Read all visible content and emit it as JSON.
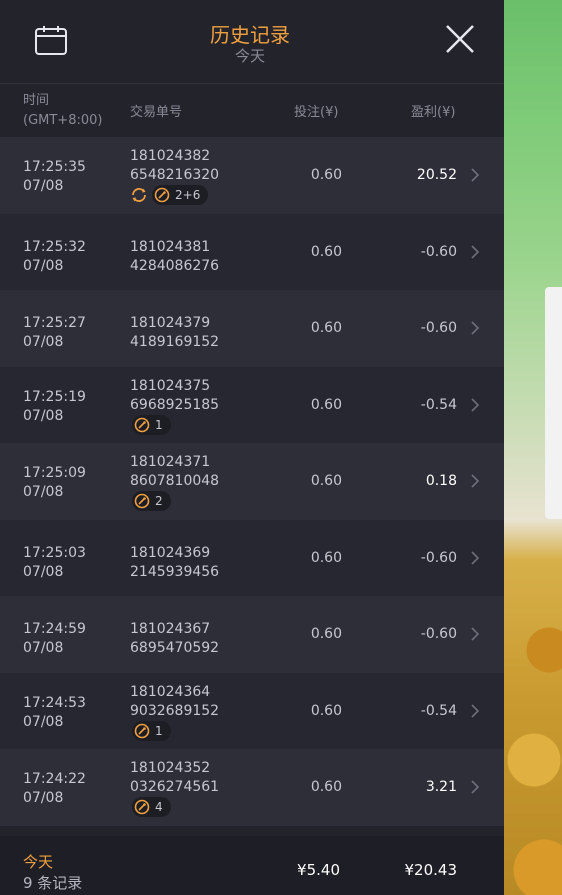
{
  "header": {
    "title": "历史记录",
    "subtitle": "今天"
  },
  "columns": {
    "time_line1": "时间",
    "time_line2": "(GMT+8:00)",
    "order": "交易单号",
    "bet": "投注(¥)",
    "profit": "盈利(¥)"
  },
  "rows": [
    {
      "time": "17:25:35",
      "date": "07/08",
      "order1": "181024382",
      "order2": "6548216320",
      "bet": "0.60",
      "profit": "20.52",
      "win": true,
      "spin": true,
      "badge": "2+6"
    },
    {
      "time": "17:25:32",
      "date": "07/08",
      "order1": "181024381",
      "order2": "4284086276",
      "bet": "0.60",
      "profit": "-0.60",
      "win": false,
      "spin": false,
      "badge": null
    },
    {
      "time": "17:25:27",
      "date": "07/08",
      "order1": "181024379",
      "order2": "4189169152",
      "bet": "0.60",
      "profit": "-0.60",
      "win": false,
      "spin": false,
      "badge": null
    },
    {
      "time": "17:25:19",
      "date": "07/08",
      "order1": "181024375",
      "order2": "6968925185",
      "bet": "0.60",
      "profit": "-0.54",
      "win": false,
      "spin": false,
      "badge": "1"
    },
    {
      "time": "17:25:09",
      "date": "07/08",
      "order1": "181024371",
      "order2": "8607810048",
      "bet": "0.60",
      "profit": "0.18",
      "win": true,
      "spin": false,
      "badge": "2"
    },
    {
      "time": "17:25:03",
      "date": "07/08",
      "order1": "181024369",
      "order2": "2145939456",
      "bet": "0.60",
      "profit": "-0.60",
      "win": false,
      "spin": false,
      "badge": null
    },
    {
      "time": "17:24:59",
      "date": "07/08",
      "order1": "181024367",
      "order2": "6895470592",
      "bet": "0.60",
      "profit": "-0.60",
      "win": false,
      "spin": false,
      "badge": null
    },
    {
      "time": "17:24:53",
      "date": "07/08",
      "order1": "181024364",
      "order2": "9032689152",
      "bet": "0.60",
      "profit": "-0.54",
      "win": false,
      "spin": false,
      "badge": "1"
    },
    {
      "time": "17:24:22",
      "date": "07/08",
      "order1": "181024352",
      "order2": "0326274561",
      "bet": "0.60",
      "profit": "3.21",
      "win": true,
      "spin": false,
      "badge": "4"
    }
  ],
  "footer": {
    "today": "今天",
    "count": "9 条记录",
    "total_bet": "¥5.40",
    "total_profit": "¥20.43"
  },
  "icons": {
    "calendar": "calendar-icon",
    "close": "close-icon",
    "row_chevron": "chevron-right-icon",
    "free_spin": "free-spin-icon",
    "feature": "feature-icon"
  },
  "colors": {
    "accent": "#f0a040",
    "panel": "#23232b",
    "row_odd": "#2e2e39",
    "row_even": "#272731",
    "text": "#c7c7d0",
    "muted": "#8a8a96"
  }
}
